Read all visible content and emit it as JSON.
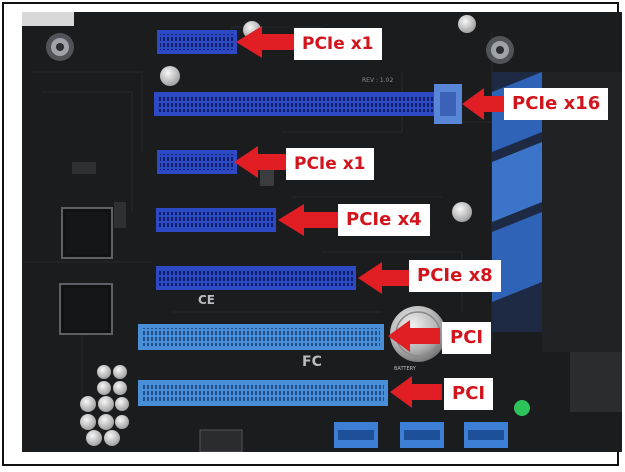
{
  "image": {
    "kind": "photo",
    "subject": "motherboard-expansion-slots",
    "colors": {
      "board": "#1b1c1e",
      "slot_pcie": "#2d49c4",
      "slot_pci": "#4a8ed8",
      "arrow": "#e01e24",
      "label_bg": "#ffffff",
      "label_text": "#d2141c"
    }
  },
  "callouts": [
    {
      "label": "PCIe x1",
      "slot_type": "pcie"
    },
    {
      "label": "PCIe x16",
      "slot_type": "pcie"
    },
    {
      "label": "PCIe x1",
      "slot_type": "pcie"
    },
    {
      "label": "PCIe x4",
      "slot_type": "pcie"
    },
    {
      "label": "PCIe x8",
      "slot_type": "pcie"
    },
    {
      "label": "PCI",
      "slot_type": "pci"
    },
    {
      "label": "PCI",
      "slot_type": "pci"
    }
  ],
  "board_markings": {
    "ce": "CE",
    "fc": "FC",
    "battery": "BATTERY",
    "rev": "REV : 1.02"
  }
}
